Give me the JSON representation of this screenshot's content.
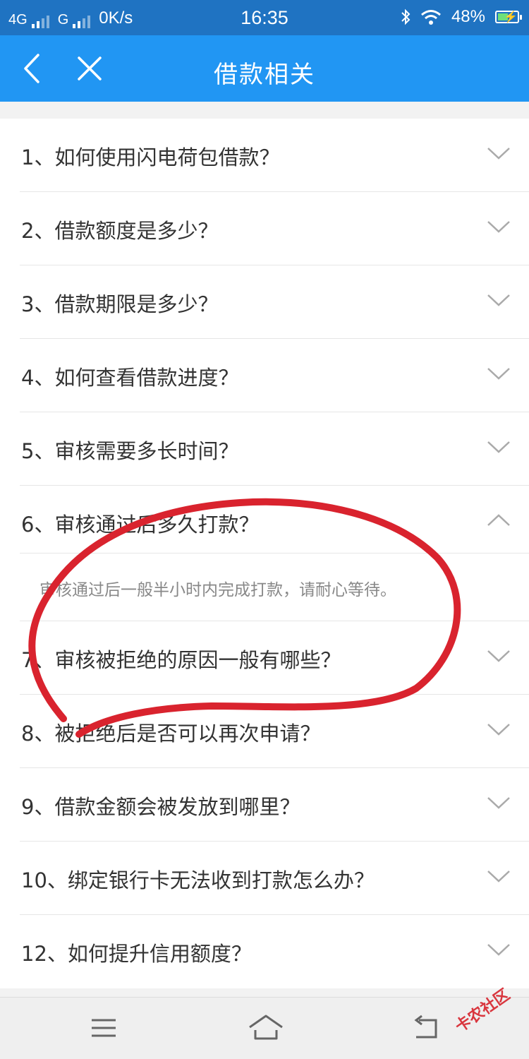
{
  "status_bar": {
    "network1": "4G",
    "network2": "G",
    "speed": "0K/s",
    "time": "16:35",
    "battery": "48%"
  },
  "nav": {
    "title": "借款相关",
    "back_icon": "chevron-left-icon",
    "close_icon": "close-icon"
  },
  "faq": {
    "items": [
      {
        "q": "1、如何使用闪电荷包借款？",
        "expanded": false
      },
      {
        "q": "2、借款额度是多少？",
        "expanded": false
      },
      {
        "q": "3、借款期限是多少？",
        "expanded": false
      },
      {
        "q": "4、如何查看借款进度？",
        "expanded": false
      },
      {
        "q": "5、审核需要多长时间？",
        "expanded": false
      },
      {
        "q": "6、审核通过后多久打款？",
        "expanded": true,
        "a": "审核通过后一般半小时内完成打款，请耐心等待。"
      },
      {
        "q": "7、审核被拒绝的原因一般有哪些？",
        "expanded": false
      },
      {
        "q": "8、被拒绝后是否可以再次申请？",
        "expanded": false
      },
      {
        "q": "9、借款金额会被发放到哪里？",
        "expanded": false
      },
      {
        "q": "10、绑定银行卡无法收到打款怎么办？",
        "expanded": false
      },
      {
        "q": "12、如何提升信用额度？",
        "expanded": false
      }
    ]
  },
  "bottom_nav": {
    "menu_icon": "menu-icon",
    "home_icon": "home-icon",
    "back_icon": "back-icon"
  },
  "watermark": "卡农社区",
  "colors": {
    "status_bar": "#1f73c2",
    "nav_bar": "#2196f3",
    "annotation": "#d9232e"
  }
}
